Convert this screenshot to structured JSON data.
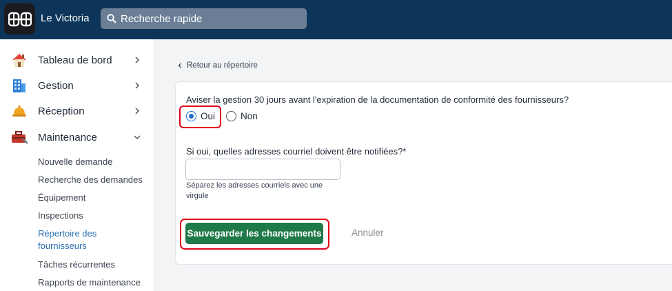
{
  "header": {
    "app_title": "Le Victoria",
    "logo_icon": "building-logo-icon",
    "search_placeholder": "Recherche rapide",
    "search_icon": "search-icon",
    "background_color": "#0d3559"
  },
  "sidebar": {
    "items": [
      {
        "label": "Tableau de bord",
        "icon": "house-icon",
        "chevron": "chevron-right-icon"
      },
      {
        "label": "Gestion",
        "icon": "office-building-icon",
        "chevron": "chevron-right-icon"
      },
      {
        "label": "Réception",
        "icon": "service-bell-icon",
        "chevron": "chevron-right-icon"
      },
      {
        "label": "Maintenance",
        "icon": "toolbox-icon",
        "chevron": "chevron-down-icon"
      }
    ],
    "maintenance_subitems": [
      "Nouvelle demande",
      "Recherche des demandes",
      "Équipement",
      "Inspections",
      "Répertoire des fournisseurs",
      "Tâches récurrentes",
      "Rapports de maintenance"
    ],
    "active_subitem": "Répertoire des fournisseurs",
    "active_color": "#2a6fb0"
  },
  "main": {
    "back_link": "Retour au répertoire",
    "question": "Aviser la gestion 30 jours avant l'expiration de la documentation de conformité des fournisseurs?",
    "options": [
      {
        "label": "Oui",
        "checked": true
      },
      {
        "label": "Non",
        "checked": false
      }
    ],
    "email_label": "Si oui, quelles adresses courriel doivent être notifiées?*",
    "email_value": "",
    "email_help": "Séparez les adresses courriels avec une virgule",
    "save_label": "Sauvegarder les changements",
    "cancel_label": "Annuler",
    "save_color": "#1f7a4a",
    "highlight_color": "#e0001a"
  }
}
